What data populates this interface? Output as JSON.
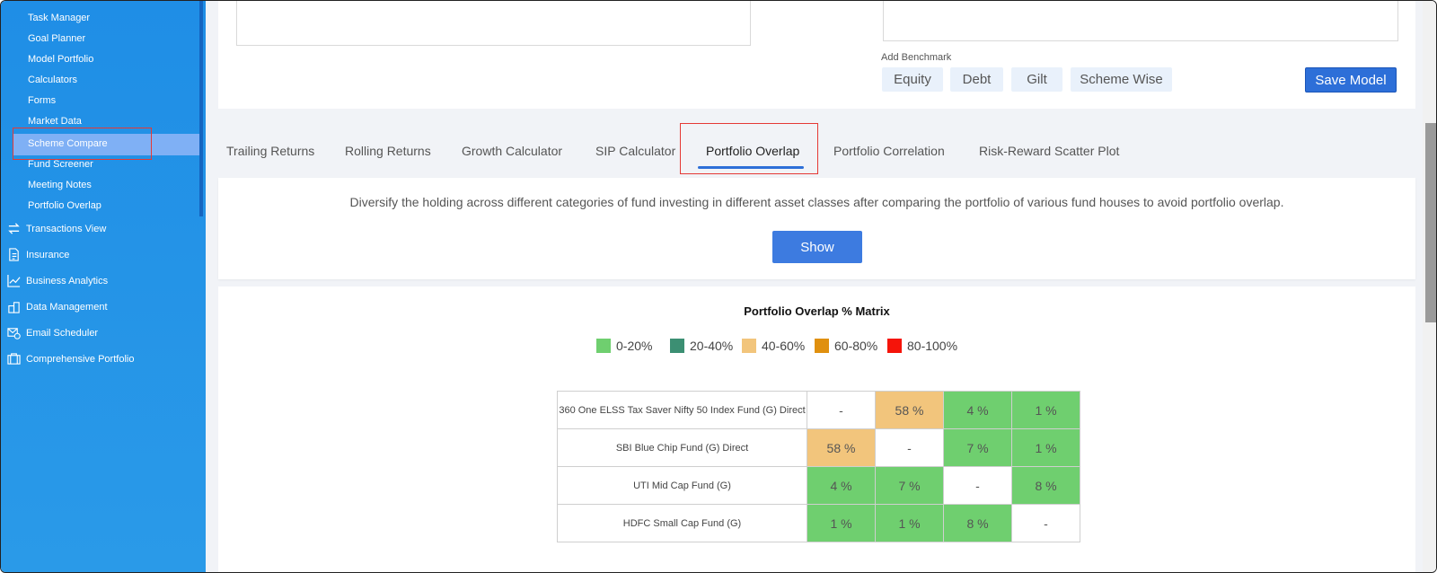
{
  "sidebar": {
    "sub_items": [
      {
        "label": "Task Manager"
      },
      {
        "label": "Goal Planner"
      },
      {
        "label": "Model Portfolio"
      },
      {
        "label": "Calculators"
      },
      {
        "label": "Forms"
      },
      {
        "label": "Market Data"
      },
      {
        "label": "Scheme Compare",
        "active": true
      },
      {
        "label": "Fund Screener"
      },
      {
        "label": "Meeting Notes"
      },
      {
        "label": "Portfolio Overlap"
      }
    ],
    "main_items": [
      {
        "label": "Transactions View",
        "icon": "transfer-icon"
      },
      {
        "label": "Insurance",
        "icon": "document-icon"
      },
      {
        "label": "Business Analytics",
        "icon": "line-chart-icon"
      },
      {
        "label": "Data Management",
        "icon": "database-icon"
      },
      {
        "label": "Email Scheduler",
        "icon": "email-clock-icon"
      },
      {
        "label": "Comprehensive Portfolio",
        "icon": "briefcase-icon"
      }
    ]
  },
  "benchmark": {
    "label": "Add Benchmark",
    "buttons": [
      "Equity",
      "Debt",
      "Gilt",
      "Scheme Wise"
    ],
    "save_label": "Save Model"
  },
  "tabs": [
    {
      "label": "Trailing Returns"
    },
    {
      "label": "Rolling Returns"
    },
    {
      "label": "Growth Calculator"
    },
    {
      "label": "SIP Calculator"
    },
    {
      "label": "Portfolio Overlap",
      "active": true
    },
    {
      "label": "Portfolio Correlation"
    },
    {
      "label": "Risk-Reward Scatter Plot"
    }
  ],
  "description": {
    "text": "Diversify the holding across different categories of fund investing in different asset classes after comparing the portfolio of various fund houses to avoid portfolio overlap.",
    "show_label": "Show"
  },
  "matrix": {
    "title": "Portfolio Overlap % Matrix",
    "legend": [
      {
        "label": "0-20%",
        "color": "#6fcf6f"
      },
      {
        "label": "20-40%",
        "color": "#3c8f73"
      },
      {
        "label": "40-60%",
        "color": "#f2c57c"
      },
      {
        "label": "60-80%",
        "color": "#e0900f"
      },
      {
        "label": "80-100%",
        "color": "#f5140a"
      }
    ],
    "rows": [
      {
        "name": "360 One ELSS Tax Saver Nifty 50 Index Fund (G) Direct",
        "cells": [
          "-",
          "58 %",
          "4 %",
          "1 %"
        ]
      },
      {
        "name": "SBI Blue Chip Fund (G) Direct",
        "cells": [
          "58 %",
          "-",
          "7 %",
          "1 %"
        ]
      },
      {
        "name": "UTI Mid Cap Fund (G)",
        "cells": [
          "4 %",
          "7 %",
          "-",
          "8 %"
        ]
      },
      {
        "name": "HDFC Small Cap Fund (G)",
        "cells": [
          "1 %",
          "1 %",
          "8 %",
          "-"
        ]
      }
    ]
  }
}
